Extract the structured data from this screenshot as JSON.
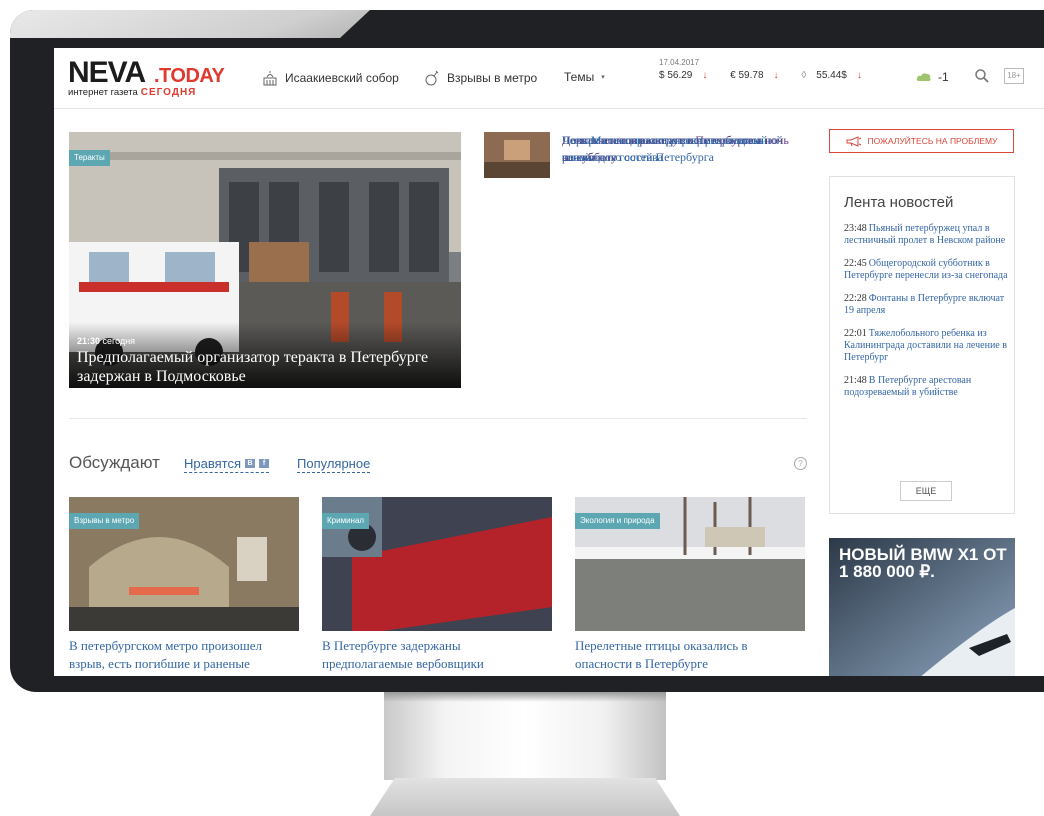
{
  "header": {
    "logo_main": "NEVA",
    "logo_accent": ".TODAY",
    "logo_sub": "интернет газета",
    "logo_sub_accent": "СЕГОДНЯ",
    "nav": [
      {
        "label": "Исаакиевский собор",
        "icon": "cathedral-icon"
      },
      {
        "label": "Взрывы в метро",
        "icon": "bomb-icon"
      },
      {
        "label": "Темы",
        "icon": "chevron-down-icon"
      }
    ],
    "rates": {
      "date": "17.04.2017",
      "usd": "$ 56.29",
      "eur": "€ 59.78",
      "oil": "55.44$",
      "down_arrow": "↓"
    },
    "weather": "-1",
    "age_rating": "18+"
  },
  "hero": {
    "tag": "Теракты",
    "time": "21:30",
    "time_suffix": "сегодня",
    "title": "Предполагаемый организатор теракта в Петербурге задержан в Подмосковье"
  },
  "news_list": [
    {
      "title": "Полтавченко просит упростить визовый режим для гостей Петербурга",
      "visited": false
    },
    {
      "title": "Парк Малиновка останется рекреационной зоной",
      "visited": false
    },
    {
      "title": "Девять мостов разведут в Петербурге в ночь на субботу",
      "visited": true
    },
    {
      "title": "Четыре станции метро закрывали из-за сломанного состава",
      "visited": false
    }
  ],
  "discuss": {
    "title": "Обсуждают",
    "tabs": [
      "Нравятся",
      "Популярное"
    ],
    "help": "?"
  },
  "cards": [
    {
      "tag": "Взрывы в метро",
      "title": "В петербургском метро произошел взрыв, есть погибшие и раненые"
    },
    {
      "tag": "Криминал",
      "title": "В Петербурге задержаны предполагаемые вербовщики"
    },
    {
      "tag": "Экология и природа",
      "title": "Перелетные птицы оказались в опасности в Петербурге"
    }
  ],
  "complain": "ПОЖАЛУЙТЕСЬ НА ПРОБЛЕМУ",
  "feed": {
    "title": "Лента новостей",
    "items": [
      {
        "time": "23:48",
        "text": "Пьяный петербуржец упал в лестничный пролет в Невском районе"
      },
      {
        "time": "22:45",
        "text": "Общегородской субботник в Петербурге перенесли из-за снегопада"
      },
      {
        "time": "22:28",
        "text": "Фонтаны в Петербурге включат 19 апреля"
      },
      {
        "time": "22:01",
        "text": "Тяжелобольного ребенка из Калининграда доставили на лечение в Петербург"
      },
      {
        "time": "21:48",
        "text": "В Петербурге арестован подозреваемый в убийстве"
      }
    ],
    "more": "ЕЩЕ"
  },
  "ad": {
    "title": "НОВЫЙ BMW X1 ОТ 1 880 000 ₽."
  },
  "colors": {
    "brand_red": "#e03a2f",
    "link_blue": "#3566a6",
    "visited": "#5a3d82",
    "tag_teal": "#5da7b3"
  }
}
